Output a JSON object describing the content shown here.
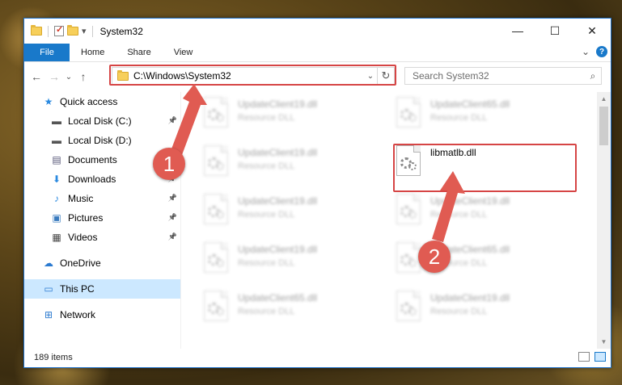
{
  "window": {
    "title": "System32",
    "controls": {
      "minimize": "—",
      "maximize": "☐",
      "close": "✕"
    }
  },
  "ribbon": {
    "tabs": [
      "File",
      "Home",
      "Share",
      "View"
    ],
    "expand": "⌄",
    "help": "?"
  },
  "nav": {
    "back": "←",
    "forward": "→",
    "recent": "⌄",
    "up": "↑",
    "address": "C:\\Windows\\System32",
    "search_placeholder": "Search System32"
  },
  "sidebar": {
    "items": [
      {
        "label": "Quick access",
        "icon": "star-icon",
        "pinned": false
      },
      {
        "label": "Local Disk (C:)",
        "icon": "drive-icon",
        "pinned": true
      },
      {
        "label": "Local Disk (D:)",
        "icon": "drive-icon",
        "pinned": false
      },
      {
        "label": "Documents",
        "icon": "documents-icon",
        "pinned": true
      },
      {
        "label": "Downloads",
        "icon": "download-icon",
        "pinned": true
      },
      {
        "label": "Music",
        "icon": "music-icon",
        "pinned": true
      },
      {
        "label": "Pictures",
        "icon": "pictures-icon",
        "pinned": true
      },
      {
        "label": "Videos",
        "icon": "videos-icon",
        "pinned": true
      },
      {
        "label": "OneDrive",
        "icon": "cloud-icon",
        "pinned": false
      },
      {
        "label": "This PC",
        "icon": "computer-icon",
        "pinned": false,
        "selected": true
      },
      {
        "label": "Network",
        "icon": "network-icon",
        "pinned": false
      }
    ]
  },
  "files": [
    {
      "name": "UpdateClient19.dll",
      "type": "Resource DLL"
    },
    {
      "name": "UpdateClient65.dll",
      "type": "Resource DLL"
    },
    {
      "name": "UpdateClient19.dll",
      "type": "Resource DLL"
    },
    {
      "name": "libmatlb.dll",
      "type": "",
      "highlighted": true
    },
    {
      "name": "UpdateClient19.dll",
      "type": "Resource DLL"
    },
    {
      "name": "UpdateClient19.dll",
      "type": "Resource DLL"
    },
    {
      "name": "UpdateClient19.dll",
      "type": "Resource DLL"
    },
    {
      "name": "UpdateClient65.dll",
      "type": "Resource DLL"
    },
    {
      "name": "UpdateClient65.dll",
      "type": "Resource DLL"
    },
    {
      "name": "UpdateClient19.dll",
      "type": "Resource DLL"
    }
  ],
  "status": {
    "count": "189 items"
  },
  "annotations": {
    "step1": "1",
    "step2": "2",
    "color": "#e05b52"
  }
}
